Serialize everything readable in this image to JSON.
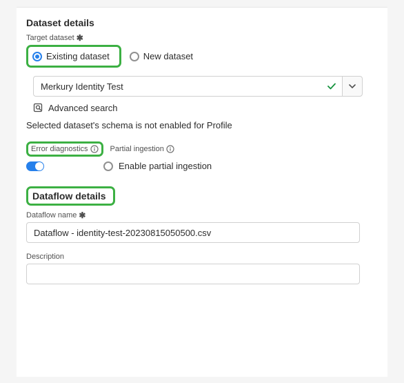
{
  "dataset": {
    "section_title": "Dataset details",
    "target_label": "Target dataset",
    "required_mark": "✱",
    "radio_existing": "Existing dataset",
    "radio_new": "New dataset",
    "selected_dataset": "Merkury Identity Test",
    "advanced_search": "Advanced search",
    "schema_note": "Selected dataset's schema is not enabled for Profile"
  },
  "diagnostics": {
    "error_label": "Error diagnostics",
    "partial_label": "Partial ingestion",
    "enable_partial": "Enable partial ingestion"
  },
  "dataflow": {
    "section_title": "Dataflow details",
    "name_label": "Dataflow name",
    "required_mark": "✱",
    "name_value": "Dataflow - identity-test-20230815050500.csv",
    "description_label": "Description",
    "description_value": ""
  },
  "colors": {
    "accent": "#2680eb",
    "highlight": "#3cb043",
    "check": "#16933e"
  }
}
